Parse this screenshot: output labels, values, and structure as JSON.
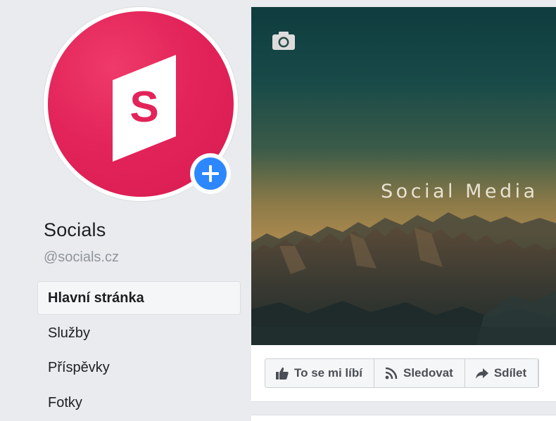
{
  "page": {
    "name": "Socials",
    "handle": "@socials.cz",
    "logo_letter": "S"
  },
  "side_nav": {
    "items": [
      {
        "label": "Hlavní stránka",
        "active": true
      },
      {
        "label": "Služby",
        "active": false
      },
      {
        "label": "Příspěvky",
        "active": false
      },
      {
        "label": "Fotky",
        "active": false
      }
    ]
  },
  "cover": {
    "title": "Social Media",
    "camera_icon": "camera-icon"
  },
  "actions": {
    "like_label": "To se mi líbí",
    "follow_label": "Sledovat",
    "share_label": "Sdílet"
  },
  "colors": {
    "brand": "#e2245a",
    "add_button": "#2d88ff",
    "background": "#e9ebee"
  }
}
